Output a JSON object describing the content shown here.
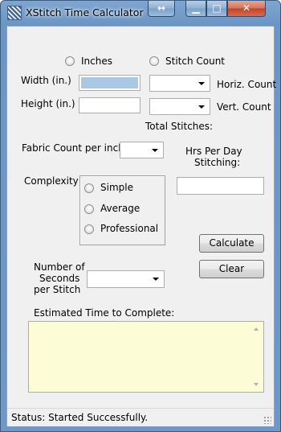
{
  "window": {
    "title": "XStitch Time Calculator",
    "buttons": {
      "resize": "↔",
      "minimize": "▁",
      "maximize": "□",
      "close": "✕"
    }
  },
  "units": {
    "inches_label": "Inches",
    "stitch_count_label": "Stitch Count"
  },
  "dimensions": {
    "width_label": "Width (in.)",
    "height_label": "Height (in.)",
    "horiz_count_label": "Horiz. Count",
    "vert_count_label": "Vert. Count",
    "total_stitches_label": "Total Stitches:"
  },
  "fabric": {
    "fabric_count_label": "Fabric Count per inch",
    "hrs_per_day_label_1": "Hrs Per Day",
    "hrs_per_day_label_2": "Stitching:"
  },
  "complexity": {
    "label": "Complexity",
    "options": [
      "Simple",
      "Average",
      "Professional"
    ]
  },
  "seconds": {
    "label_1": "Number of",
    "label_2": "Seconds",
    "label_3": "per Stitch"
  },
  "actions": {
    "calculate": "Calculate",
    "clear": "Clear"
  },
  "estimate": {
    "label": "Estimated Time to Complete:"
  },
  "status": {
    "text": "Status: Started Successfully."
  }
}
